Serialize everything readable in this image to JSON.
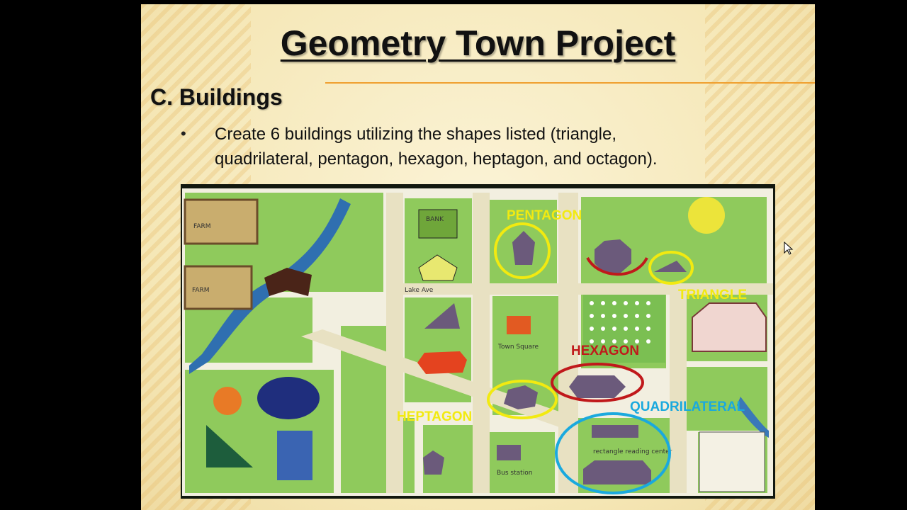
{
  "slide": {
    "title": "Geometry Town Project",
    "heading": "C. Buildings",
    "bullet_symbol": "•",
    "bullet_line_1": "Create 6 buildings utilizing the shapes listed (triangle,",
    "bullet_line_2": "quadrilateral, pentagon, hexagon, heptagon, and octagon)."
  },
  "map": {
    "labels": {
      "pentagon": "PENTAGON",
      "triangle": "TRIANGLE",
      "hexagon": "HEXAGON",
      "quadrilateral": "QUADRILATERAL",
      "heptagon": "HEPTAGON"
    },
    "handwriting": {
      "farm_1": "FARM",
      "farm_2": "FARM",
      "lake_ave": "Lake Ave",
      "bank": "BANK",
      "town_square": "Town Square",
      "rectangle_reading_center": "rectangle reading center",
      "bus_station": "Bus station"
    },
    "colors": {
      "yellow": "#f2ea10",
      "red": "#c0191b",
      "blue": "#1aa9de",
      "grass": "#8fca5c",
      "road": "#e8e1c2",
      "building": "#6b5a7b"
    }
  },
  "icons": {
    "cursor": "mouse-pointer-icon"
  }
}
